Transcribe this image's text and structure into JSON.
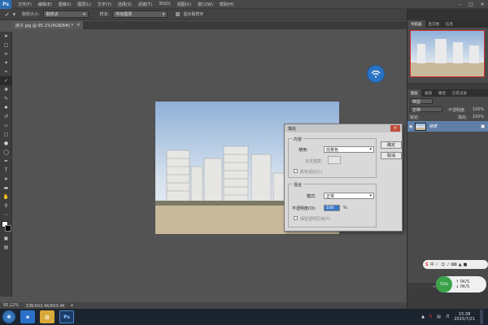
{
  "app": {
    "logo": "Ps"
  },
  "menubar": {
    "items": [
      "文件(F)",
      "编辑(E)",
      "图像(I)",
      "图层(L)",
      "文字(Y)",
      "选择(S)",
      "滤镜(T)",
      "3D(D)",
      "视图(V)",
      "窗口(W)",
      "帮助(H)"
    ]
  },
  "optbar": {
    "sample_size_label": "取样大小:",
    "sample_size_value": "取样点",
    "sample_label": "样本:",
    "sample_value": "所有图层",
    "show_ring_label": "显示取样环"
  },
  "document": {
    "tab_title": "房子.jpg @ 95.1%(RGB/8#) *",
    "tab_close": "×"
  },
  "statusbar": {
    "zoom": "95.12%",
    "doc_info": "文档:603.4K/603.4K"
  },
  "dialog": {
    "title": "填充",
    "close_icon": "close-icon",
    "contents_legend": "内容",
    "use_label": "使用:",
    "use_value": "前景色",
    "custom_pattern_label": "自定图案:",
    "color_adapt_label": "颜色适应(C)",
    "blending_legend": "混合",
    "mode_label": "模式:",
    "mode_value": "正常",
    "opacity_label": "不透明度(O):",
    "opacity_value": "100",
    "opacity_unit": "%",
    "preserve_label": "保留透明区域(P)",
    "ok_label": "确定",
    "cancel_label": "取消"
  },
  "panels": {
    "nav_tabs": [
      "导航器",
      "直方图",
      "信息"
    ],
    "layers_tabs": [
      "图层",
      "通道",
      "路径",
      "历史记录"
    ],
    "kind_label": "类型",
    "blend_mode": "正常",
    "opacity_label": "不透明度:",
    "opacity_value": "100%",
    "lock_label": "锁定:",
    "fill_label": "填充:",
    "fill_value": "100%",
    "layer_name": "背景"
  },
  "tray_widgets": {
    "net_percent": "55%",
    "up_speed": "0K/S",
    "down_speed": "0K/S",
    "ime_label": "中"
  },
  "taskbar": {
    "time": "15:38",
    "date": "2015/7/21"
  },
  "colors": {
    "accent_blue": "#2b73c4",
    "dialog_bg": "#d9d9d9",
    "ps_dark": "#535353"
  }
}
